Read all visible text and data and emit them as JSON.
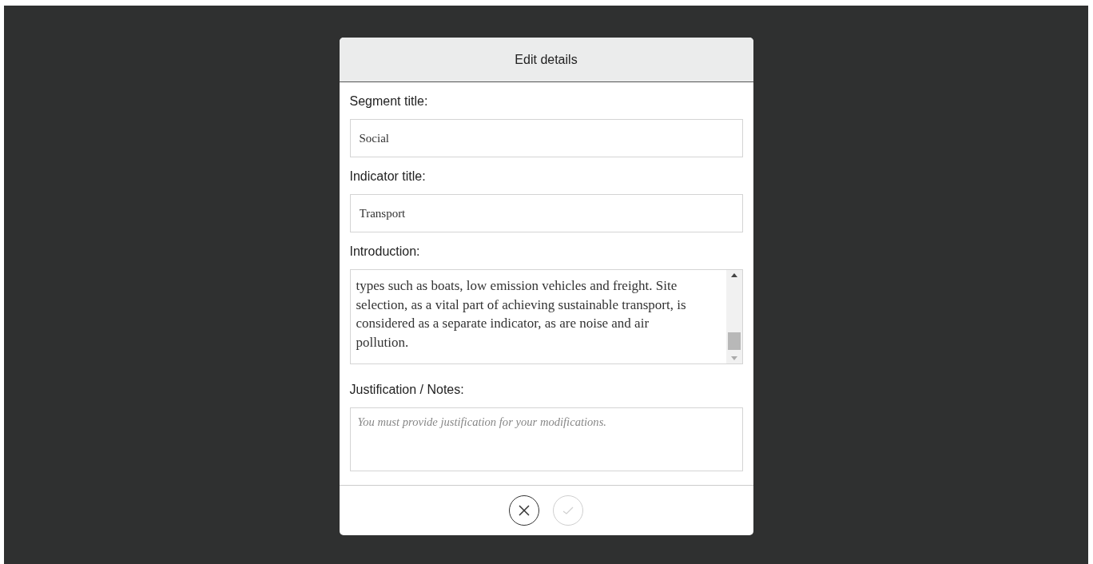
{
  "dialog": {
    "title": "Edit details",
    "fields": [
      {
        "kind": "input",
        "label": "Segment title:",
        "value": "Social"
      },
      {
        "kind": "input",
        "label": "Indicator title:",
        "value": "Transport"
      },
      {
        "kind": "textarea",
        "label": "Introduction:",
        "value": "types such as boats, low emission vehicles and freight. Site selection, as a vital part of achieving sustainable transport, is considered as a separate indicator, as are noise and air pollution."
      },
      {
        "kind": "notes",
        "label": "Justification / Notes:",
        "placeholder": "You must provide justification for your modifications."
      }
    ],
    "buttons": [
      {
        "kind": "cancel",
        "disabled": false
      },
      {
        "kind": "confirm",
        "disabled": true
      }
    ]
  }
}
